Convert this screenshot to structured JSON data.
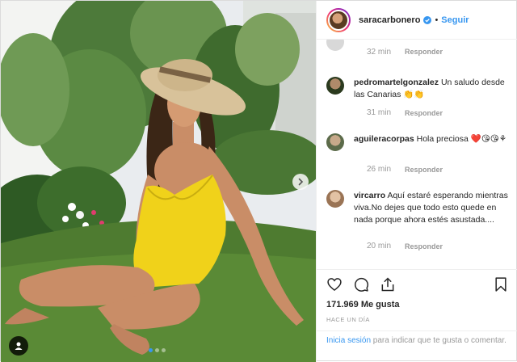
{
  "header": {
    "username": "saracarbonero",
    "separator": "•",
    "follow_label": "Seguir"
  },
  "comments": [
    {
      "username": "",
      "text": "",
      "age": "32 min",
      "reply_label": "Responder"
    },
    {
      "username": "pedromartelgonzalez",
      "text": "Un saludo desde las Canarias 👏👏",
      "age": "31 min",
      "reply_label": "Responder"
    },
    {
      "username": "aguileracorpas",
      "text": "Hola preciosa ❤️😘😘⚘",
      "age": "26 min",
      "reply_label": "Responder"
    },
    {
      "username": "vircarro",
      "text": "Aquí estaré esperando mientras viva.No dejes que todo esto quede en nada porque ahora estés asustada....",
      "age": "20 min",
      "reply_label": "Responder"
    }
  ],
  "actions": {
    "likes": "171.969 Me gusta",
    "timestamp": "HACE UN DÍA"
  },
  "login": {
    "link_label": "Inicia sesión",
    "rest": " para indicar que te gusta o comentar."
  },
  "carousel": {
    "slide_count": 3,
    "active_index": 0
  },
  "colors": {
    "accent": "#3897f0",
    "swimsuit": "#f0d21a",
    "grass": "#3f6b2a"
  },
  "icons": [
    "heart-icon",
    "comment-icon",
    "share-icon",
    "bookmark-icon",
    "chevron-right-icon",
    "user-tag-icon",
    "verified-badge-icon"
  ]
}
